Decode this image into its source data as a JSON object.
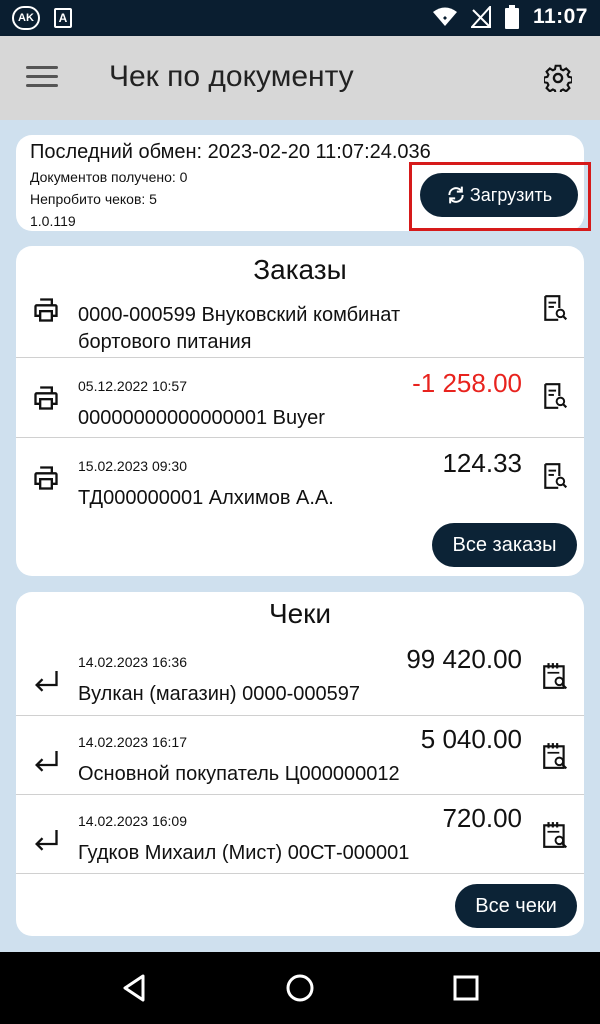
{
  "status_bar": {
    "time": "11:07"
  },
  "app_bar": {
    "title": "Чек по документу"
  },
  "sync": {
    "last_exchange": "Последний обмен: 2023-02-20 11:07:24.036",
    "docs_received": "Документов получено: 0",
    "unpunched": "Непробито чеков: 5",
    "version": "1.0.119",
    "load_label": "Загрузить"
  },
  "orders": {
    "title": "Заказы",
    "rows": [
      {
        "date": "",
        "name": "0000-000599 Внуковский комбинат бортового питания",
        "amount": ""
      },
      {
        "date": "05.12.2022 10:57",
        "name": "00000000000000001 Buyer",
        "amount": "-1 258.00"
      },
      {
        "date": "15.02.2023 09:30",
        "name": "ТД000000001 Алхимов А.А.",
        "amount": "124.33"
      }
    ],
    "all_label": "Все заказы"
  },
  "receipts": {
    "title": "Чеки",
    "rows": [
      {
        "date": "14.02.2023 16:36",
        "name": "Вулкан (магазин) 0000-000597",
        "amount": "99 420.00"
      },
      {
        "date": "14.02.2023 16:17",
        "name": "Основной покупатель Ц000000012",
        "amount": "5 040.00"
      },
      {
        "date": "14.02.2023 16:09",
        "name": "Гудков Михаил (Мист) 00СТ-000001",
        "amount": "720.00"
      }
    ],
    "all_label": "Все чеки"
  },
  "colors": {
    "accent": "#0c2336",
    "negative": "#e8231e",
    "highlight": "#d61a1a",
    "background": "#cfe0ee"
  }
}
